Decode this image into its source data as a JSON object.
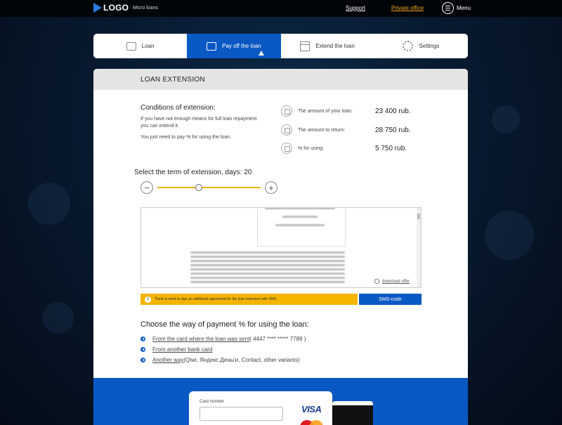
{
  "header": {
    "logo_text": "LOGO",
    "logo_sub": "Micro loans",
    "support": "Support",
    "private_office": "Private office",
    "menu": "Menu"
  },
  "tabs": [
    {
      "label": "Loan",
      "icon": "wallet-icon",
      "active": false
    },
    {
      "label": "Pay off the loan",
      "icon": "wallet-icon",
      "active": true
    },
    {
      "label": "Extend the loan",
      "icon": "calendar-icon",
      "active": false
    },
    {
      "label": "Settings",
      "icon": "gear-icon",
      "active": false
    }
  ],
  "panel": {
    "title": "LOAN EXTENSION",
    "conditions_title": "Conditions of extension:",
    "conditions_text": "If you have not enough means for full loan repayment you can extend it.",
    "conditions_text2": "You just need to pay % for using the loan.",
    "amounts": [
      {
        "label": "The amount of your loan:",
        "value": "23 400 rub."
      },
      {
        "label": "The amount to return:",
        "value": "28 750 rub."
      },
      {
        "label": "% for using:",
        "value": "5 750 rub."
      }
    ],
    "term_label": "Select the term of extension, days: 20",
    "slider_fraction": 0.4
  },
  "document": {
    "download_label": "download offer"
  },
  "notice": {
    "text": "There is need to sign an additional agreement for the loan extension with SMS",
    "sms_button": "SMS-code"
  },
  "payment": {
    "title": "Choose the way of payment % for using the loan:",
    "items": [
      {
        "link": "From the card where the loan was sent",
        "extra": " ( 4447 **** ***** 7789 )"
      },
      {
        "link": "From another bank card",
        "extra": ""
      },
      {
        "link": "Another way",
        "extra": " (Qiwi, Яндекс.Деньги, Contact, other variants)"
      }
    ]
  },
  "card": {
    "number_label": "Card number",
    "brand1": "VISA",
    "brand2": "MasterCard"
  },
  "colors": {
    "accent_blue": "#0a58c4",
    "accent_yellow": "#f4b400",
    "private_link": "#f2a31b"
  }
}
